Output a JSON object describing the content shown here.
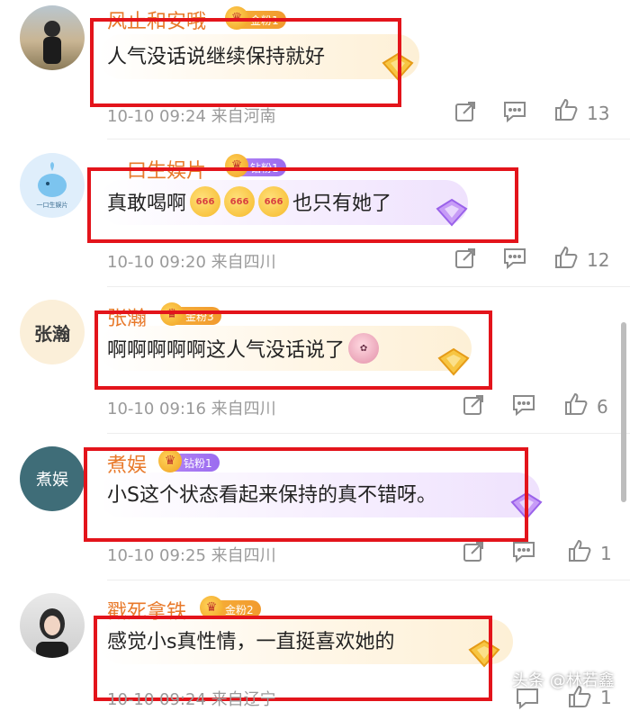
{
  "comments": [
    {
      "username": "风止和安哦",
      "badge": "金粉1",
      "text": "人气没话说继续保持就好",
      "meta": "10-10 09:24  来自河南",
      "likes": "13",
      "icons": [
        "share-icon",
        "comment-icon",
        "like-icon"
      ],
      "accent": "#f0a020"
    },
    {
      "username": "一口生娱片",
      "badge": "钻粉1",
      "text_before": "真敢喝啊",
      "emoji_label": "666",
      "text_after": "也只有她了",
      "meta": "10-10 09:20  来自四川",
      "likes": "12",
      "avatar_text": "一口生娱片"
    },
    {
      "username": "张瀚",
      "badge": "金粉3",
      "text": "啊啊啊啊啊这人气没话说了",
      "meta": "10-10 09:16  来自四川",
      "likes": "6",
      "avatar_text": "张瀚"
    },
    {
      "username": "煮娱",
      "badge": "钻粉1",
      "text": "小S这个状态看起来保持的真不错呀。",
      "meta": "10-10 09:25  来自四川",
      "likes": "1",
      "avatar_text": "煮娱"
    },
    {
      "username": "戳死拿铁",
      "badge": "金粉2",
      "text": "感觉小s真性情，一直挺喜欢她的",
      "meta": "10-10 09:24  来自辽宁",
      "likes": "1"
    }
  ],
  "watermark": "头条 @林若鑫",
  "colors": {
    "username": "#e8792a",
    "highlight_box": "#e3141b",
    "meta": "#9a9a9a"
  }
}
